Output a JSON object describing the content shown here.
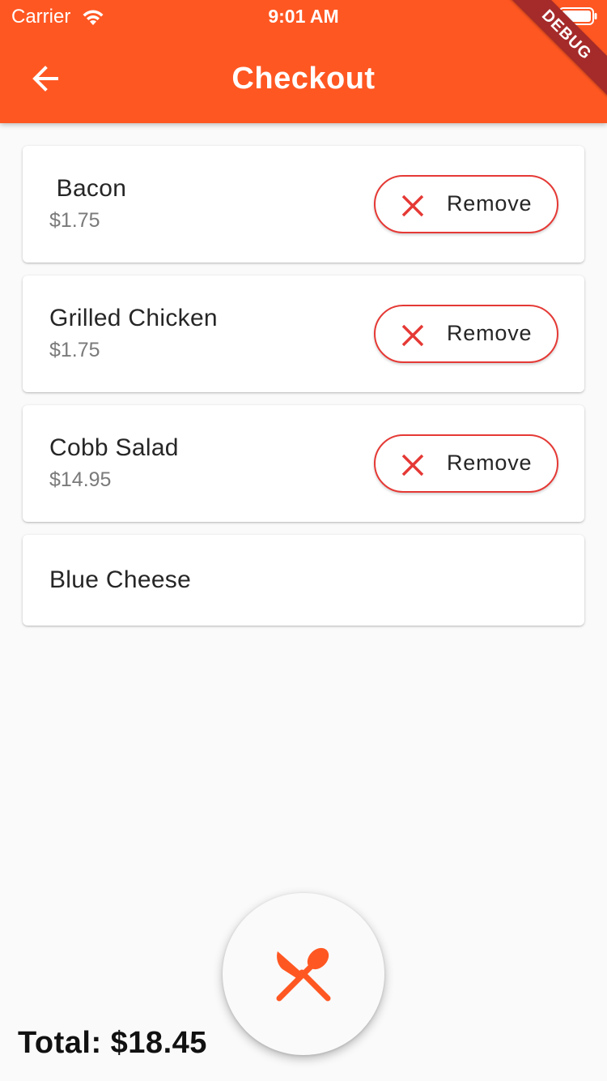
{
  "status_bar": {
    "carrier": "Carrier",
    "time": "9:01 AM",
    "icons": [
      "wifi-icon",
      "battery-icon"
    ]
  },
  "app_bar": {
    "title": "Checkout",
    "back_icon": "arrow-back-icon",
    "debug_banner": "DEBUG",
    "color": "#ff5722"
  },
  "cart": {
    "items": [
      {
        "name": " Bacon",
        "price": "$1.75",
        "action_label": "Remove"
      },
      {
        "name": "Grilled Chicken",
        "price": "$1.75",
        "action_label": "Remove"
      },
      {
        "name": "Cobb Salad",
        "price": "$14.95",
        "action_label": "Remove"
      },
      {
        "name": "Blue Cheese"
      }
    ],
    "remove_icon": "close-icon",
    "remove_color": "#e53935"
  },
  "fab": {
    "icon": "utensils-icon"
  },
  "footer": {
    "total": "Total: $18.45"
  }
}
